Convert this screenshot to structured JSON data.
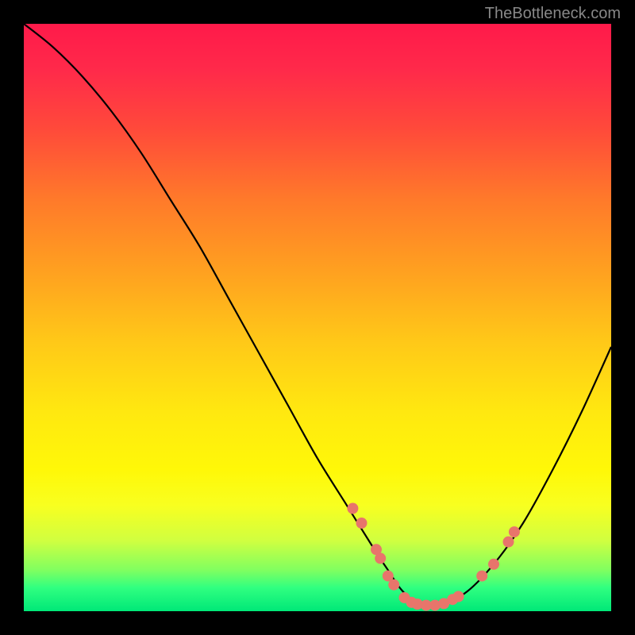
{
  "watermark": "TheBottleneck.com",
  "chart_data": {
    "type": "line",
    "title": "",
    "xlabel": "",
    "ylabel": "",
    "xlim": [
      0,
      100
    ],
    "ylim": [
      0,
      100
    ],
    "series": [
      {
        "name": "bottleneck-curve",
        "x": [
          0,
          5,
          10,
          15,
          20,
          25,
          30,
          35,
          40,
          45,
          50,
          55,
          60,
          62,
          64,
          66,
          68,
          70,
          75,
          80,
          85,
          90,
          95,
          100
        ],
        "y": [
          100,
          96,
          91,
          85,
          78,
          70,
          62,
          53,
          44,
          35,
          26,
          18,
          10,
          7,
          4,
          2,
          1,
          1,
          3,
          8,
          15,
          24,
          34,
          45
        ]
      }
    ],
    "markers": [
      {
        "x": 56.0,
        "y": 17.5
      },
      {
        "x": 57.5,
        "y": 15.0
      },
      {
        "x": 60.0,
        "y": 10.5
      },
      {
        "x": 60.7,
        "y": 9.0
      },
      {
        "x": 62.0,
        "y": 6.0
      },
      {
        "x": 63.0,
        "y": 4.5
      },
      {
        "x": 64.8,
        "y": 2.3
      },
      {
        "x": 66.0,
        "y": 1.5
      },
      {
        "x": 67.0,
        "y": 1.2
      },
      {
        "x": 68.5,
        "y": 1.0
      },
      {
        "x": 70.0,
        "y": 1.0
      },
      {
        "x": 71.5,
        "y": 1.3
      },
      {
        "x": 73.0,
        "y": 2.0
      },
      {
        "x": 74.0,
        "y": 2.5
      },
      {
        "x": 78.0,
        "y": 6.0
      },
      {
        "x": 80.0,
        "y": 8.0
      },
      {
        "x": 82.5,
        "y": 11.8
      },
      {
        "x": 83.5,
        "y": 13.5
      }
    ],
    "marker_color": "#e8756b",
    "curve_color": "#000000"
  }
}
